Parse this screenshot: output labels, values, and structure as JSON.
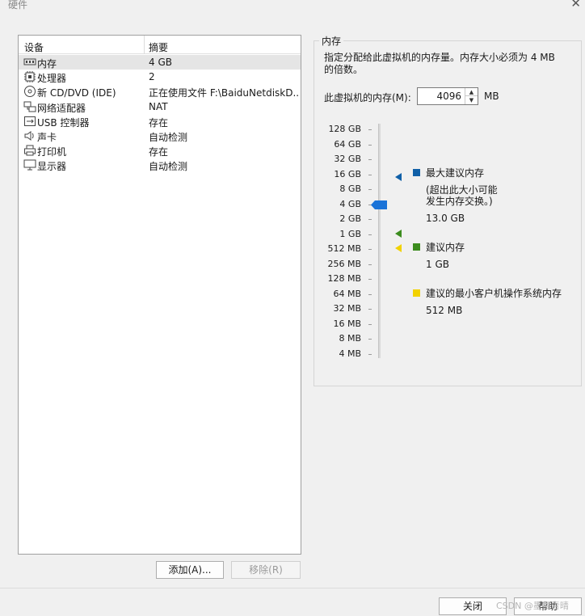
{
  "window": {
    "title": "硬件"
  },
  "devices": {
    "columns": [
      "设备",
      "摘要"
    ],
    "rows": [
      {
        "name": "内存",
        "summary": "4 GB",
        "icon": "memory-icon"
      },
      {
        "name": "处理器",
        "summary": "2",
        "icon": "cpu-icon"
      },
      {
        "name": "新 CD/DVD (IDE)",
        "summary": "正在使用文件 F:\\BaiduNetdiskD...",
        "icon": "cd-icon"
      },
      {
        "name": "网络适配器",
        "summary": "NAT",
        "icon": "network-icon"
      },
      {
        "name": "USB 控制器",
        "summary": "存在",
        "icon": "usb-icon"
      },
      {
        "name": "声卡",
        "summary": "自动检测",
        "icon": "speaker-icon"
      },
      {
        "name": "打印机",
        "summary": "存在",
        "icon": "printer-icon"
      },
      {
        "name": "显示器",
        "summary": "自动检测",
        "icon": "monitor-icon"
      }
    ]
  },
  "buttons": {
    "add": "添加(A)...",
    "remove": "移除(R)",
    "close": "关闭",
    "help": "帮助"
  },
  "memory": {
    "group_title": "内存",
    "description": "指定分配给此虚拟机的内存量。内存大小必须为 4 MB 的倍数。",
    "field_label": "此虚拟机的内存(M):",
    "value": "4096",
    "unit": "MB",
    "scale": [
      "128 GB",
      "64 GB",
      "32 GB",
      "16 GB",
      "8 GB",
      "4 GB",
      "2 GB",
      "1 GB",
      "512 MB",
      "256 MB",
      "128 MB",
      "64 MB",
      "32 MB",
      "16 MB",
      "8 MB",
      "4 MB"
    ],
    "legend": {
      "max": {
        "title": "最大建议内存",
        "note1": "(超出此大小可能",
        "note2": "发生内存交换。)",
        "value": "13.0 GB",
        "color": "#1060a8"
      },
      "recommended": {
        "title": "建议内存",
        "value": "1 GB",
        "color": "#3c8c1e"
      },
      "minimum": {
        "title": "建议的最小客户机操作系统内存",
        "value": "512 MB",
        "color": "#f2d200"
      }
    },
    "thumb_color": "#1a73d8"
  },
  "watermark": "CSDN @墨舞青晴"
}
